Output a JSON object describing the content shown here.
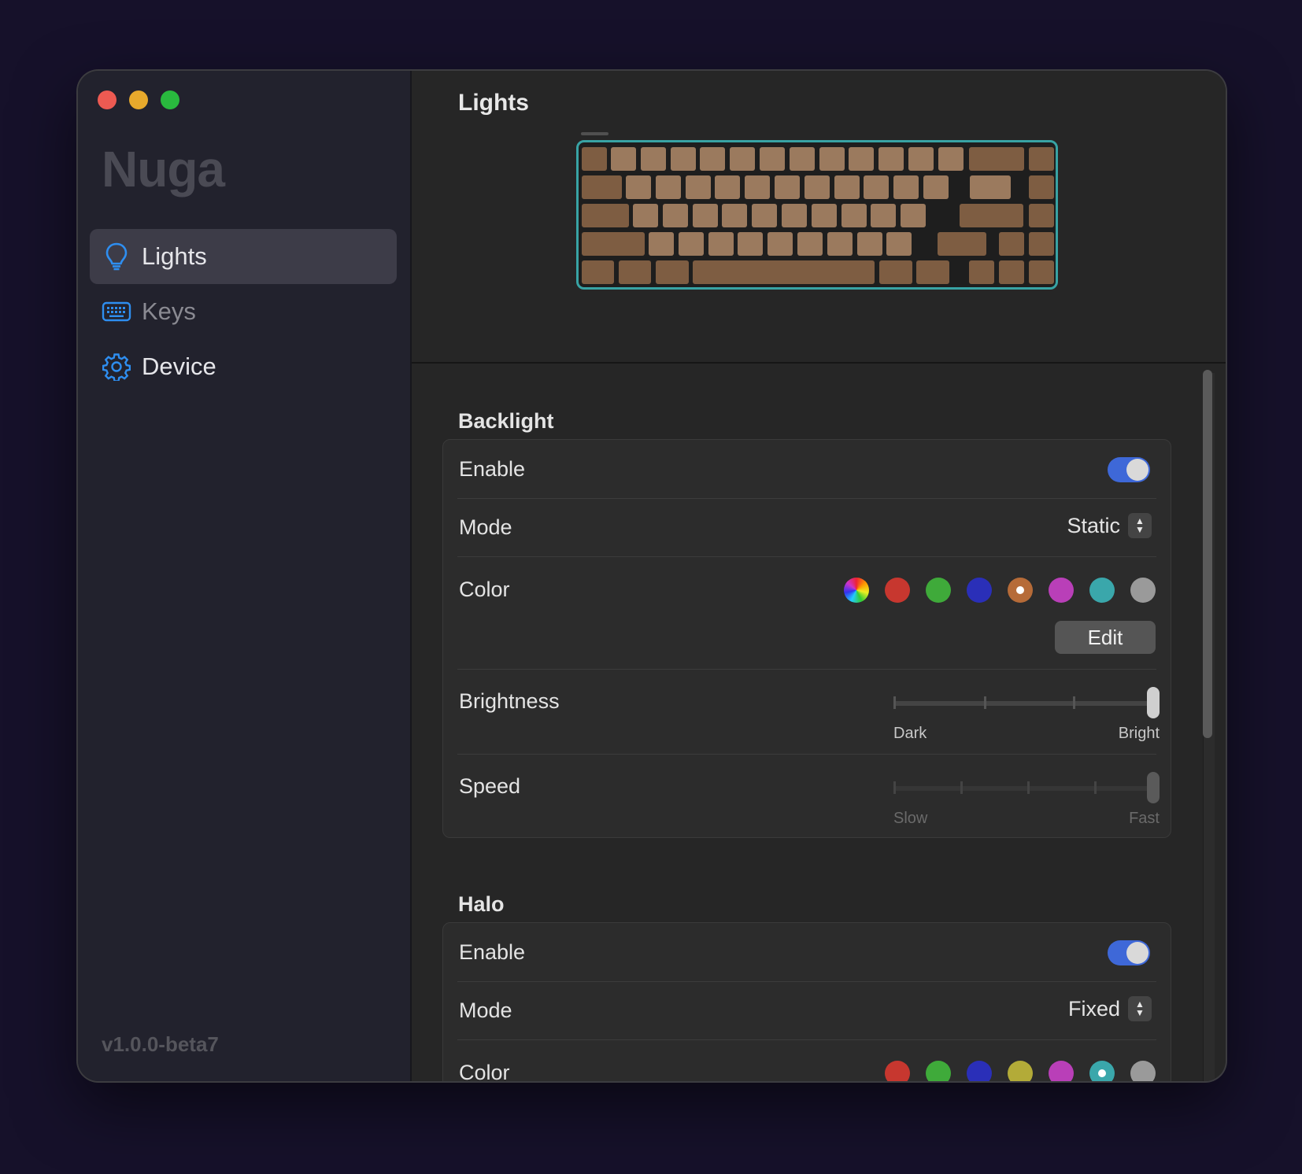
{
  "app": {
    "name": "Nuga",
    "version": "v1.0.0-beta7"
  },
  "sidebar": {
    "items": [
      {
        "label": "Lights",
        "icon": "lightbulb-icon",
        "active": true
      },
      {
        "label": "Keys",
        "icon": "keyboard-icon",
        "active": false
      },
      {
        "label": "Device",
        "icon": "gear-icon",
        "active": false
      }
    ]
  },
  "main": {
    "title": "Lights"
  },
  "backlight": {
    "title": "Backlight",
    "enable_label": "Enable",
    "enabled": true,
    "mode_label": "Mode",
    "mode_value": "Static",
    "color_label": "Color",
    "colors": [
      "rainbow",
      "#c7372f",
      "#3faa3a",
      "#2a2fb8",
      "#b66b38",
      "#b93fb8",
      "#3aa7ab",
      "#9a9a9a"
    ],
    "selected_color_index": 4,
    "edit_label": "Edit",
    "brightness_label": "Brightness",
    "brightness_value": 1.0,
    "brightness_min": "Dark",
    "brightness_max": "Bright",
    "speed_label": "Speed",
    "speed_value": 1.0,
    "speed_min": "Slow",
    "speed_max": "Fast"
  },
  "halo": {
    "title": "Halo",
    "enable_label": "Enable",
    "enabled": true,
    "mode_label": "Mode",
    "mode_value": "Fixed",
    "color_label": "Color",
    "colors": [
      "#c7372f",
      "#3faa3a",
      "#2a2fb8",
      "#b3ab38",
      "#b93fb8",
      "#3aa7ab",
      "#9a9a9a"
    ],
    "selected_color_index": 5
  },
  "colors": {
    "accent": "#3e68d8",
    "keyboard_outline": "#38a3a4",
    "key_light": "#9b7a5e",
    "key_dark": "#7e5d42"
  }
}
